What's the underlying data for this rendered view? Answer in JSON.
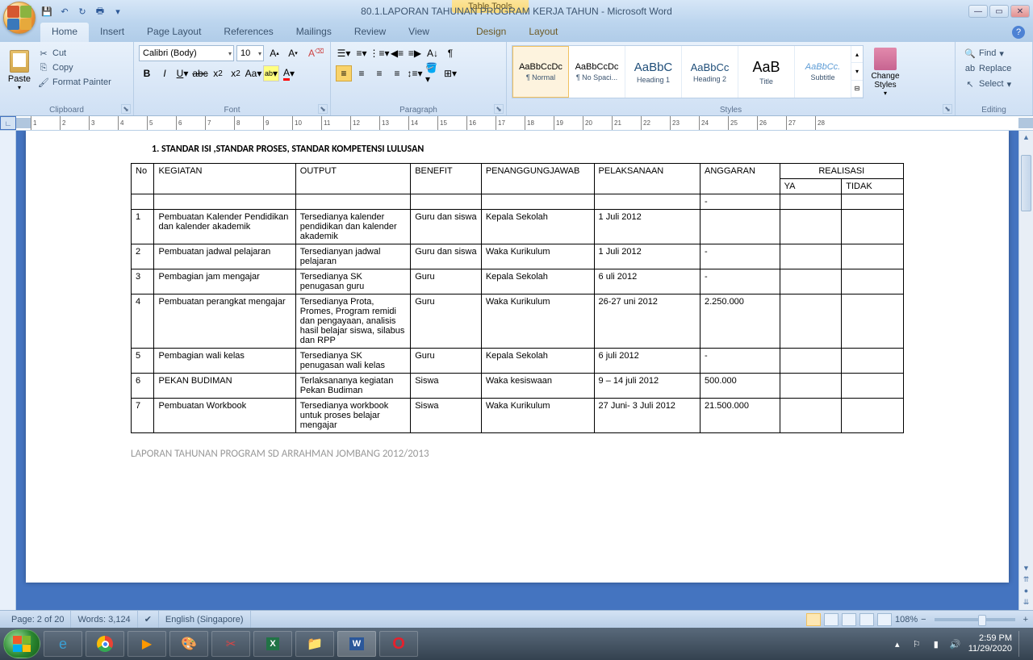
{
  "titlebar": {
    "context_tab": "Table Tools",
    "doc_title": "80.1.LAPORAN TAHUNAN PROGRAM KERJA TAHUN - Microsoft Word"
  },
  "tabs": {
    "home": "Home",
    "insert": "Insert",
    "page_layout": "Page Layout",
    "references": "References",
    "mailings": "Mailings",
    "review": "Review",
    "view": "View",
    "design": "Design",
    "layout": "Layout"
  },
  "ribbon": {
    "clipboard": {
      "label": "Clipboard",
      "paste": "Paste",
      "cut": "Cut",
      "copy": "Copy",
      "format_painter": "Format Painter"
    },
    "font": {
      "label": "Font",
      "name": "Calibri (Body)",
      "size": "10"
    },
    "paragraph": {
      "label": "Paragraph"
    },
    "styles": {
      "label": "Styles",
      "items": [
        {
          "preview": "AaBbCcDc",
          "name": "¶ Normal",
          "sel": true,
          "color": "#000"
        },
        {
          "preview": "AaBbCcDc",
          "name": "¶ No Spaci...",
          "sel": false,
          "color": "#000"
        },
        {
          "preview": "AaBbC",
          "name": "Heading 1",
          "sel": false,
          "color": "#1f4e79",
          "size": "15px"
        },
        {
          "preview": "AaBbCc",
          "name": "Heading 2",
          "sel": false,
          "color": "#1f4e79",
          "size": "13px"
        },
        {
          "preview": "AaB",
          "name": "Title",
          "sel": false,
          "color": "#000",
          "size": "18px"
        },
        {
          "preview": "AaBbCc.",
          "name": "Subtitle",
          "sel": false,
          "color": "#5b9bd5",
          "style": "italic"
        }
      ],
      "change": "Change Styles"
    },
    "editing": {
      "label": "Editing",
      "find": "Find",
      "replace": "Replace",
      "select": "Select"
    }
  },
  "document": {
    "heading": "1.    STANDAR ISI ,STANDAR PROSES, STANDAR KOMPETENSI  LULUSAN",
    "footer": "LAPORAN TAHUNAN PROGRAM SD ARRAHMAN JOMBANG 2012/2013",
    "headers": {
      "no": "No",
      "kegiatan": "KEGIATAN",
      "output": "OUTPUT",
      "benefit": "BENEFIT",
      "pj": "PENANGGUNGJAWAB",
      "pelaks": "PELAKSANAAN",
      "anggaran": "ANGGARAN",
      "realisasi": "REALISASI",
      "ya": "YA",
      "tidak": "TIDAK"
    },
    "rows": [
      {
        "no": "1",
        "kegiatan": "Pembuatan Kalender Pendidikan dan kalender akademik",
        "output": "Tersedianya kalender pendidikan dan kalender akademik",
        "benefit": "Guru dan siswa",
        "pj": "Kepala Sekolah",
        "pelaks": "1 Juli 2012",
        "anggaran": ""
      },
      {
        "no": "2",
        "kegiatan": "Pembuatan jadwal pelajaran",
        "output": "Tersedianyan jadwal pelajaran",
        "benefit": "Guru dan siswa",
        "pj": "Waka Kurikulum",
        "pelaks": "1 Juli 2012",
        "anggaran": "-"
      },
      {
        "no": "3",
        "kegiatan": "Pembagian jam mengajar",
        "output": "Tersedianya SK penugasan guru",
        "benefit": "Guru",
        "pj": "Kepala Sekolah",
        "pelaks": "6 uli 2012",
        "anggaran": "-"
      },
      {
        "no": "4",
        "kegiatan": "Pembuatan perangkat mengajar",
        "output": "Tersedianya Prota, Promes, Program remidi dan pengayaan, analisis hasil belajar siswa, silabus dan RPP",
        "benefit": "Guru",
        "pj": "Waka Kurikulum",
        "pelaks": "26-27 uni 2012",
        "anggaran": "2.250.000"
      },
      {
        "no": "5",
        "kegiatan": "Pembagian wali kelas",
        "output": "Tersedianya SK penugasan wali kelas",
        "benefit": "Guru",
        "pj": "Kepala Sekolah",
        "pelaks": "6 juli 2012",
        "anggaran": "-"
      },
      {
        "no": "6",
        "kegiatan": "PEKAN BUDIMAN",
        "output": "Terlaksananya kegiatan Pekan Budiman",
        "benefit": "Siswa",
        "pj": "Waka kesiswaan",
        "pelaks": "9 – 14 juli 2012",
        "anggaran": "500.000"
      },
      {
        "no": "7",
        "kegiatan": "Pembuatan Workbook",
        "output": "Tersedianya workbook untuk proses belajar mengajar",
        "benefit": "Siswa",
        "pj": "Waka Kurikulum",
        "pelaks": "27 Juni- 3 Juli 2012",
        "anggaran": "21.500.000"
      }
    ]
  },
  "statusbar": {
    "page": "Page: 2 of 20",
    "words": "Words: 3,124",
    "lang": "English (Singapore)",
    "zoom": "108%"
  },
  "taskbar": {
    "time": "2:59 PM",
    "date": "11/29/2020"
  }
}
